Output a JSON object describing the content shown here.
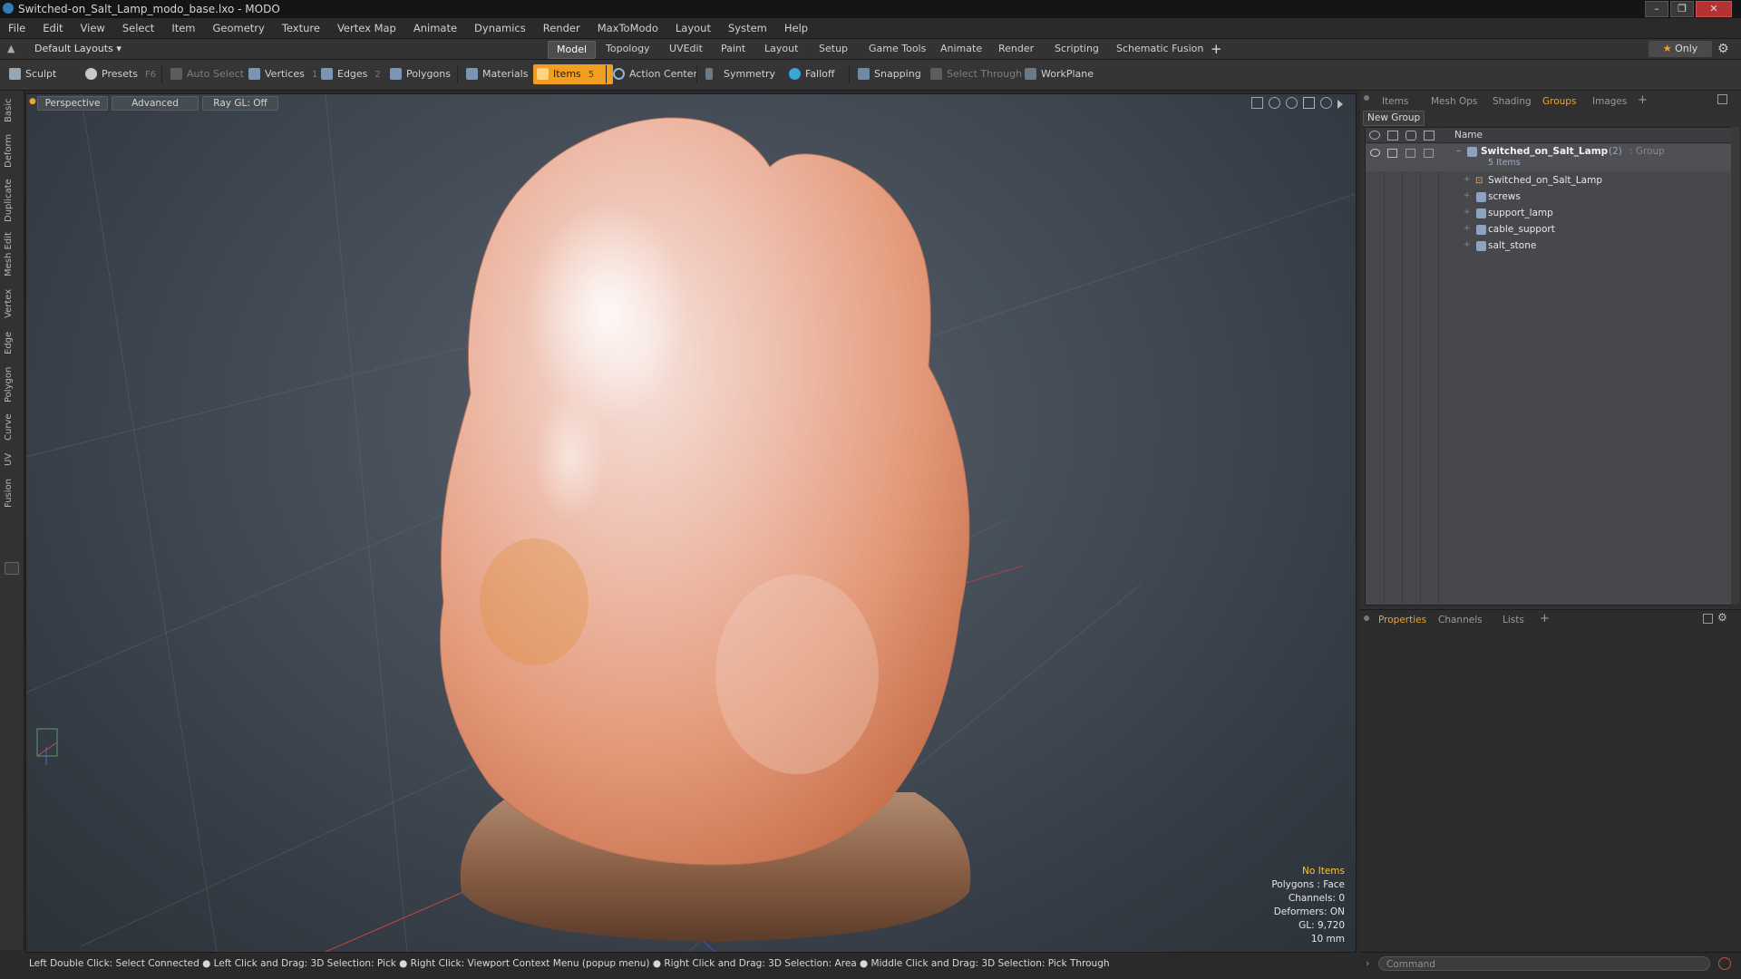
{
  "window": {
    "title": "Switched-on_Salt_Lamp_modo_base.lxo - MODO"
  },
  "menu": [
    "File",
    "Edit",
    "View",
    "Select",
    "Item",
    "Geometry",
    "Texture",
    "Vertex Map",
    "Animate",
    "Dynamics",
    "Render",
    "MaxToModo",
    "Layout",
    "System",
    "Help"
  ],
  "layoutbar": {
    "layouts_label": "Default Layouts",
    "tabs": [
      "Model",
      "Topology",
      "UVEdit",
      "Paint",
      "Layout",
      "Setup",
      "Game Tools",
      "Animate",
      "Render",
      "Scripting",
      "Schematic Fusion"
    ],
    "active_tab": "Model",
    "only_label": "Only"
  },
  "toolbar": {
    "sculpt": "Sculpt",
    "presets": "Presets",
    "presets_key": "F6",
    "auto_select": "Auto Select",
    "vertices": "Vertices",
    "vertices_num": "1",
    "edges": "Edges",
    "edges_num": "2",
    "polygons": "Polygons",
    "materials": "Materials",
    "items": "Items",
    "items_num": "5",
    "action_center": "Action Center",
    "symmetry": "Symmetry",
    "falloff": "Falloff",
    "snapping": "Snapping",
    "select_through": "Select Through",
    "workplane": "WorkPlane"
  },
  "left_tabs": [
    "Basic",
    "Deform",
    "Duplicate",
    "Mesh Edit",
    "Vertex",
    "Edge",
    "Polygon",
    "Curve",
    "UV",
    "Fusion"
  ],
  "viewport": {
    "perspective": "Perspective",
    "advanced": "Advanced",
    "raygl": "Ray GL: Off",
    "stats": {
      "no_items": "No Items",
      "polygons": "Polygons : Face",
      "channels": "Channels: 0",
      "deformers": "Deformers: ON",
      "gl": "GL: 9,720",
      "scale": "10 mm"
    }
  },
  "right_panel": {
    "tabs": [
      "Items",
      "Mesh Ops",
      "Shading",
      "Groups",
      "Images"
    ],
    "active_tab": "Groups",
    "new_group": "New Group",
    "name_header": "Name",
    "group": {
      "name": "Switched_on_Salt_Lamp",
      "count": "(2)",
      "type": ": Group",
      "items_label": "5 Items"
    },
    "children": [
      "Switched_on_Salt_Lamp",
      "screws",
      "support_lamp",
      "cable_support",
      "salt_stone"
    ],
    "bottom_tabs": [
      "Properties",
      "Channels",
      "Lists"
    ],
    "bottom_active": "Properties"
  },
  "status": {
    "hint": "Left Double Click: Select Connected ● Left Click and Drag: 3D Selection: Pick ● Right Click: Viewport Context Menu (popup menu) ● Right Click and Drag: 3D Selection: Area ● Middle Click and Drag: 3D Selection: Pick Through",
    "command_placeholder": "Command"
  },
  "colors": {
    "accent": "#f29e20",
    "warn": "#ffc23a"
  }
}
